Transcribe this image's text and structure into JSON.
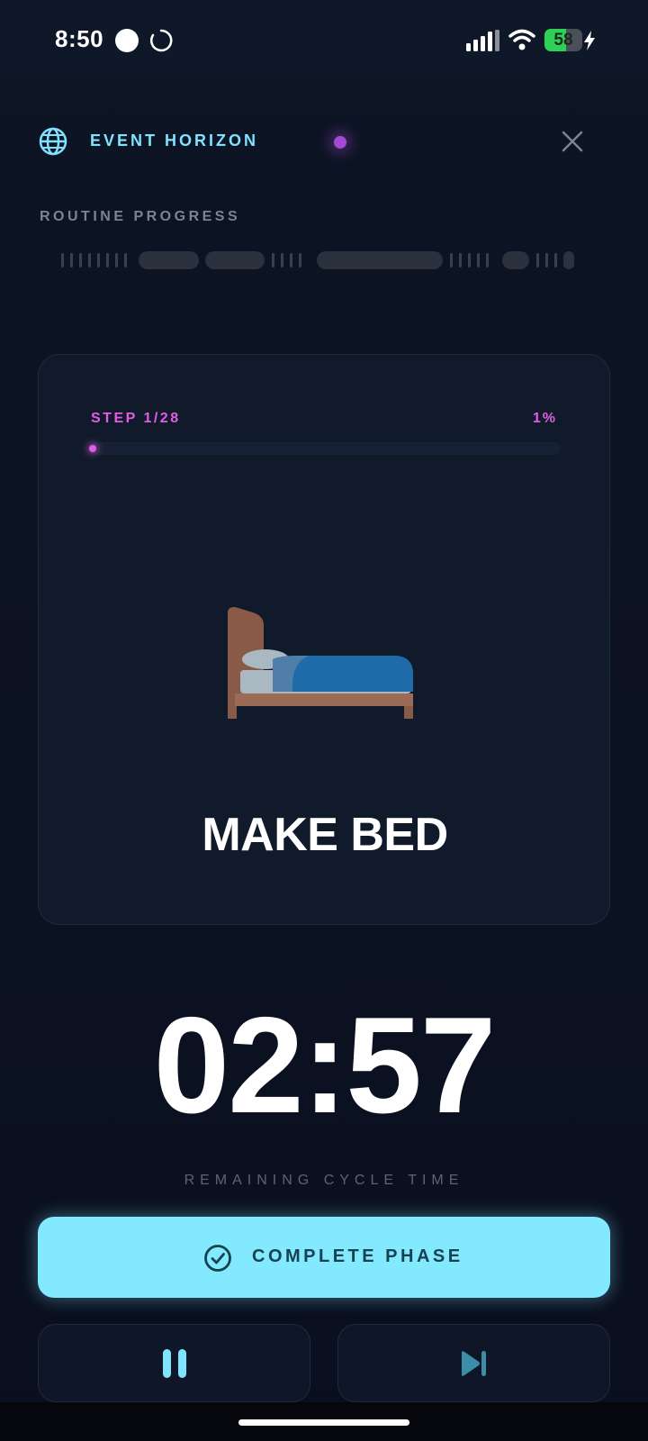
{
  "status_bar": {
    "time": "8:50",
    "battery_level": "58",
    "battery_fraction": 0.58
  },
  "header": {
    "title": "EVENT HORIZON",
    "icons": [
      "globe-icon",
      "close-icon"
    ]
  },
  "routine": {
    "label": "ROUTINE PROGRESS"
  },
  "card": {
    "step_label": "STEP 1/28",
    "step_percent": "1%",
    "step_fraction": 0.01,
    "task_title": "MAKE BED",
    "task_icon": "bed-icon"
  },
  "timer": {
    "value": "02:57",
    "caption": "REMAINING CYCLE TIME"
  },
  "actions": {
    "complete_label": "COMPLETE PHASE",
    "pause_icon": "pause-icon",
    "skip_icon": "skip-next-icon"
  },
  "colors": {
    "accent_cyan": "#82e9ff",
    "accent_magenta": "#e25de6",
    "background": "#0b1120"
  }
}
